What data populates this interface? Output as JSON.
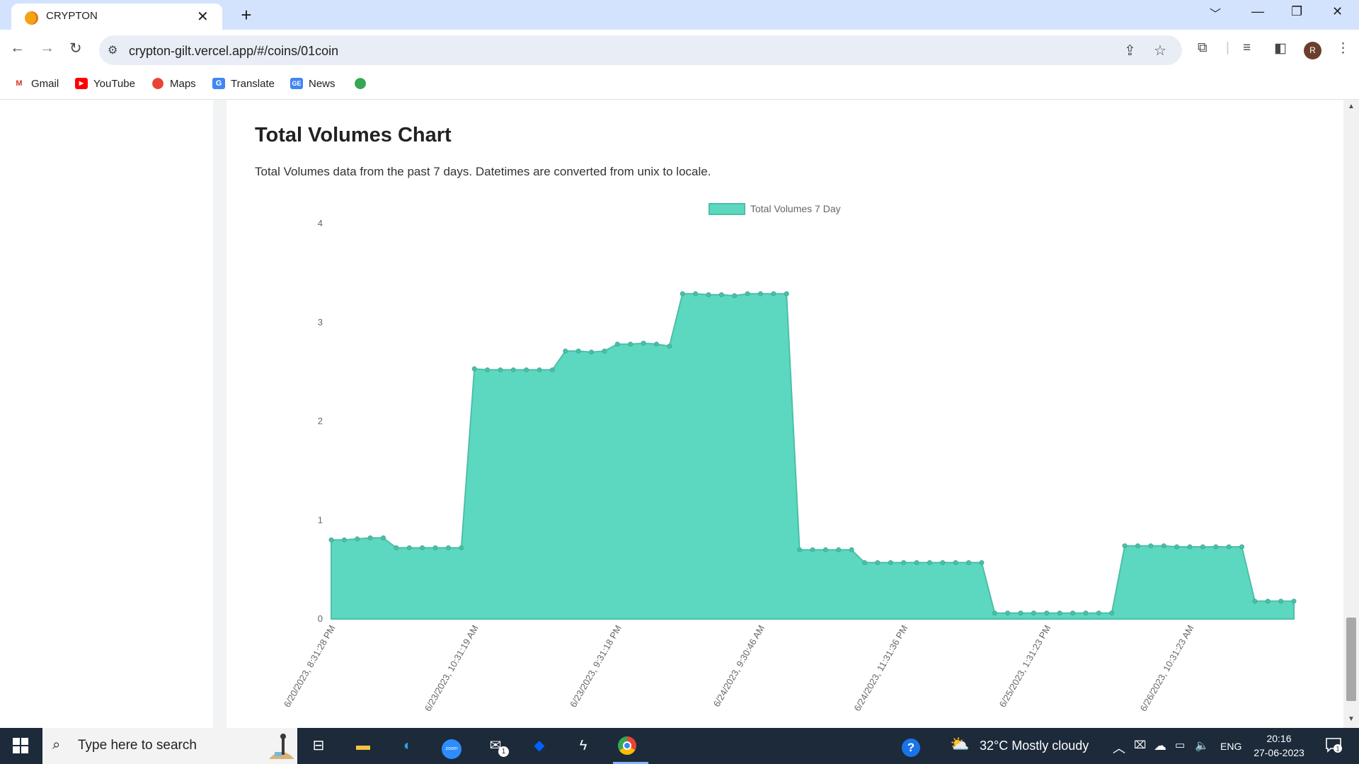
{
  "browser": {
    "tab_title": "CRYPTON",
    "url": "crypton-gilt.vercel.app/#/coins/01coin",
    "avatar_initial": "R",
    "bookmarks": [
      {
        "label": "Gmail",
        "icon": "gmail-icon"
      },
      {
        "label": "YouTube",
        "icon": "youtube-icon"
      },
      {
        "label": "Maps",
        "icon": "maps-icon"
      },
      {
        "label": "Translate",
        "icon": "translate-icon"
      },
      {
        "label": "News",
        "icon": "news-icon"
      },
      {
        "label": "",
        "icon": "maps-pin-icon"
      }
    ]
  },
  "page": {
    "heading": "Total Volumes Chart",
    "description": "Total Volumes data from the past 7 days. Datetimes are converted from unix to locale."
  },
  "chart_data": {
    "type": "area",
    "legend": "Total Volumes 7 Day",
    "legend_position": "top",
    "fill_color": "#5dd8c0",
    "line_color": "#4cbfa8",
    "ylim": [
      0,
      4
    ],
    "y_ticks": [
      0,
      1,
      2,
      3,
      4
    ],
    "x_tick_labels": [
      "6/20/2023, 8:31:28 PM",
      "6/23/2023, 10:31:19 AM",
      "6/23/2023, 9:31:18 PM",
      "6/24/2023, 9:30:46 AM",
      "6/24/2023, 11:31:36 PM",
      "6/25/2023, 1:31:23 PM",
      "6/26/2023, 10:31:23 AM"
    ],
    "values": [
      0.8,
      0.8,
      0.81,
      0.82,
      0.82,
      0.72,
      0.72,
      0.72,
      0.72,
      0.72,
      0.72,
      2.53,
      2.52,
      2.52,
      2.52,
      2.52,
      2.52,
      2.52,
      2.71,
      2.71,
      2.7,
      2.71,
      2.78,
      2.78,
      2.79,
      2.78,
      2.76,
      3.29,
      3.29,
      3.28,
      3.28,
      3.27,
      3.29,
      3.29,
      3.29,
      3.29,
      0.7,
      0.7,
      0.7,
      0.7,
      0.7,
      0.57,
      0.57,
      0.57,
      0.57,
      0.57,
      0.57,
      0.57,
      0.57,
      0.57,
      0.57,
      0.06,
      0.06,
      0.06,
      0.06,
      0.06,
      0.06,
      0.06,
      0.06,
      0.06,
      0.06,
      0.74,
      0.74,
      0.74,
      0.74,
      0.73,
      0.73,
      0.73,
      0.73,
      0.73,
      0.73,
      0.18,
      0.18,
      0.18,
      0.18
    ]
  },
  "taskbar": {
    "search_placeholder": "Type here to search",
    "weather": "32°C  Mostly cloudy",
    "language": "ENG",
    "time": "20:16",
    "date": "27-06-2023",
    "mail_badge": "1",
    "notification_count": "1"
  }
}
